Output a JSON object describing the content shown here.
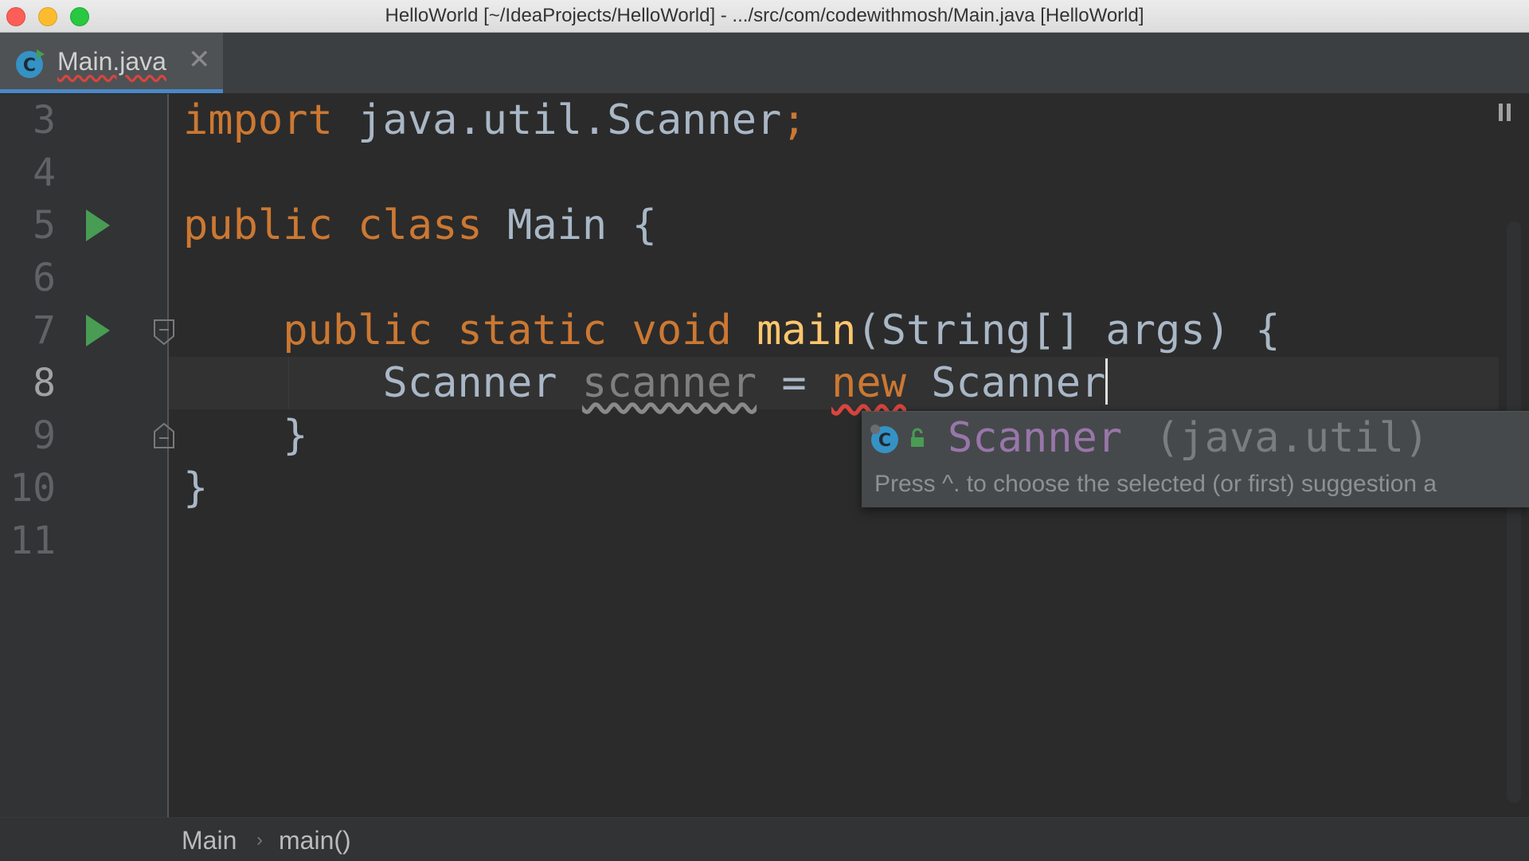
{
  "window": {
    "title": "HelloWorld [~/IdeaProjects/HelloWorld] - .../src/com/codewithmosh/Main.java [HelloWorld]"
  },
  "tabs": [
    {
      "label": "Main.java",
      "icon": "java-class-icon",
      "active": true
    }
  ],
  "editor": {
    "current_line": 8,
    "line_numbers": [
      "3",
      "4",
      "5",
      "6",
      "7",
      "8",
      "9",
      "10",
      "11"
    ],
    "code": {
      "l3_kw": "import",
      "l3_rest": " java.util.Scanner",
      "l3_semi": ";",
      "l5_kw1": "public",
      "l5_kw2": "class",
      "l5_name": "Main",
      "l5_brace": "{",
      "l7_kw1": "public",
      "l7_kw2": "static",
      "l7_kw3": "void",
      "l7_fn": "main",
      "l7_params": "(String[] args) {",
      "l8_type": "Scanner",
      "l8_var": "scanner",
      "l8_eq": " = ",
      "l8_new": "new",
      "l8_class": "Scanner",
      "l9_brace": "}",
      "l10_brace": "}"
    }
  },
  "completion": {
    "item_name": "Scanner",
    "item_package": "(java.util)",
    "hint": "Press ^. to choose the selected (or first) suggestion a"
  },
  "breadcrumbs": [
    "Main",
    "main()"
  ],
  "colors": {
    "keyword": "#cc7832",
    "identifier": "#a9b7c6",
    "method": "#ffc66d",
    "class_suggestion": "#9876aa",
    "run_icon": "#499c54"
  }
}
